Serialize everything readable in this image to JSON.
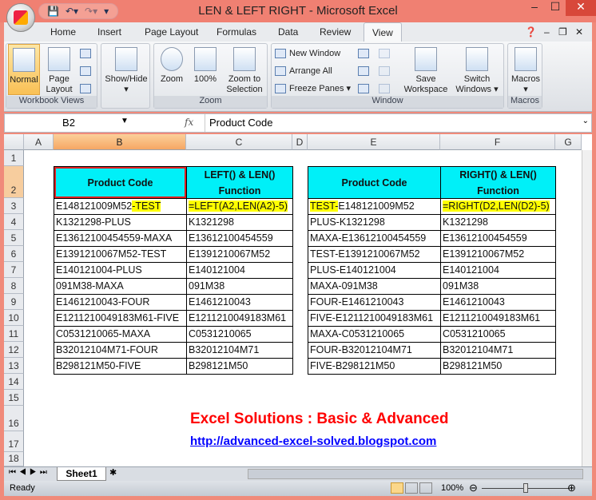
{
  "window": {
    "title": "LEN & LEFT RIGHT - Microsoft Excel"
  },
  "ribbon_tabs": [
    "Home",
    "Insert",
    "Page Layout",
    "Formulas",
    "Data",
    "Review",
    "View"
  ],
  "ribbon": {
    "groups": {
      "workbook_views": "Workbook Views",
      "zoom": "Zoom",
      "window": "Window",
      "macros": "Macros"
    },
    "buttons": {
      "normal": "Normal",
      "page_layout_1": "Page",
      "page_layout_2": "Layout",
      "show_hide": "Show/Hide",
      "zoom": "Zoom",
      "hundred": "100%",
      "zoom_sel_1": "Zoom to",
      "zoom_sel_2": "Selection",
      "new_window": "New Window",
      "arrange_all": "Arrange All",
      "freeze_panes": "Freeze Panes",
      "save_ws_1": "Save",
      "save_ws_2": "Workspace",
      "switch_1": "Switch",
      "switch_2": "Windows",
      "macros": "Macros"
    }
  },
  "formula_bar": {
    "name_box": "B2",
    "fx": "fx",
    "value": "Product Code"
  },
  "columns": [
    "A",
    "B",
    "C",
    "D",
    "E",
    "F",
    "G"
  ],
  "rows": [
    "1",
    "2",
    "3",
    "4",
    "5",
    "6",
    "7",
    "8",
    "9",
    "10",
    "11",
    "12",
    "13",
    "14",
    "15",
    "16",
    "17",
    "18"
  ],
  "table_left": {
    "headers": [
      "Product Code",
      "LEFT() & LEN()",
      "Function"
    ],
    "first_row": {
      "b_plain": "E148121009M52",
      "b_hl": "-TEST",
      "c": "=LEFT(A2,LEN(A2)-5)"
    },
    "rows": [
      [
        "K1321298-PLUS",
        "K1321298"
      ],
      [
        "E13612100454559-MAXA",
        "E13612100454559"
      ],
      [
        "E1391210067M52-TEST",
        "E1391210067M52"
      ],
      [
        "E140121004-PLUS",
        "E140121004"
      ],
      [
        "091M38-MAXA",
        "091M38"
      ],
      [
        "E1461210043-FOUR",
        "E1461210043"
      ],
      [
        "E1211210049183M61-FIVE",
        "E1211210049183M61"
      ],
      [
        "C0531210065-MAXA",
        "C0531210065"
      ],
      [
        "B32012104M71-FOUR",
        "B32012104M71"
      ],
      [
        "B298121M50-FIVE",
        "B298121M50"
      ]
    ]
  },
  "table_right": {
    "headers": [
      "Product Code",
      "RIGHT() & LEN()",
      "Function"
    ],
    "first_row": {
      "e_hl": "TEST-",
      "e_plain": "E148121009M52",
      "f": "=RIGHT(D2,LEN(D2)-5)"
    },
    "rows": [
      [
        "PLUS-K1321298",
        "K1321298"
      ],
      [
        "MAXA-E13612100454559",
        "E13612100454559"
      ],
      [
        "TEST-E1391210067M52",
        "E1391210067M52"
      ],
      [
        "PLUS-E140121004",
        "E140121004"
      ],
      [
        "MAXA-091M38",
        "091M38"
      ],
      [
        "FOUR-E1461210043",
        "E1461210043"
      ],
      [
        "FIVE-E1211210049183M61",
        "E1211210049183M61"
      ],
      [
        "MAXA-C0531210065",
        "C0531210065"
      ],
      [
        "FOUR-B32012104M71",
        "B32012104M71"
      ],
      [
        "FIVE-B298121M50",
        "B298121M50"
      ]
    ]
  },
  "promo": {
    "title": "Excel Solutions : Basic & Advanced",
    "link": "http://advanced-excel-solved.blogspot.com"
  },
  "sheet_tabs": [
    "Sheet1"
  ],
  "status": {
    "ready": "Ready",
    "zoom": "100%",
    "zoom_fraction": 0.5
  }
}
